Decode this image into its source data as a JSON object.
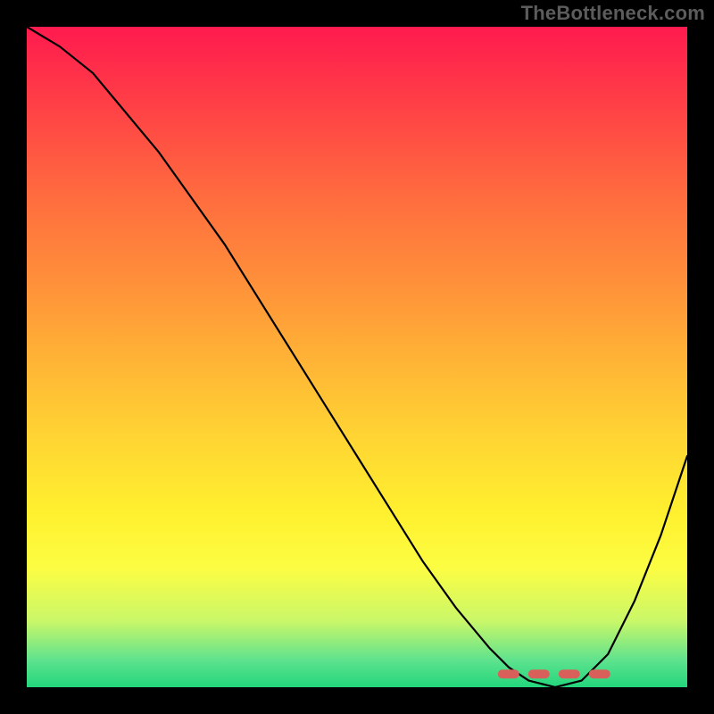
{
  "watermark": "TheBottleneck.com",
  "colors": {
    "background": "#000000",
    "curve": "#000000",
    "optimal_marker": "#d9605a",
    "gradient_top": "#ff1a4f",
    "gradient_bottom": "#23d67c"
  },
  "chart_data": {
    "type": "line",
    "title": "",
    "xlabel": "",
    "ylabel": "",
    "xlim": [
      0,
      100
    ],
    "ylim": [
      0,
      100
    ],
    "grid": false,
    "legend": false,
    "series": [
      {
        "name": "bottleneck-curve",
        "x": [
          0,
          5,
          10,
          15,
          20,
          25,
          30,
          35,
          40,
          45,
          50,
          55,
          60,
          65,
          70,
          73,
          76,
          80,
          84,
          88,
          92,
          96,
          100
        ],
        "values": [
          100,
          97,
          93,
          87,
          81,
          74,
          67,
          59,
          51,
          43,
          35,
          27,
          19,
          12,
          6,
          3,
          1,
          0,
          1,
          5,
          13,
          23,
          35
        ]
      }
    ],
    "optimal_range": {
      "x_start": 72,
      "x_end": 88,
      "y_start": 2,
      "y_end": 2
    }
  }
}
